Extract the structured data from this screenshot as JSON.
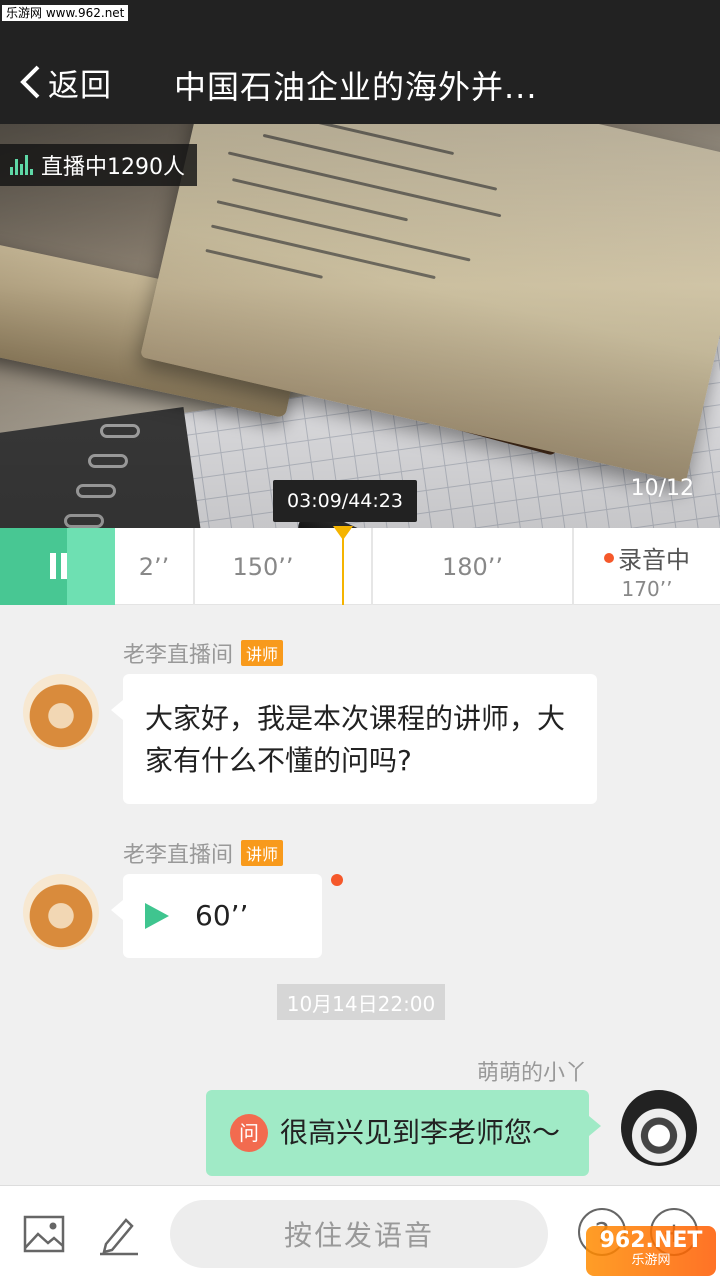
{
  "watermark": {
    "top": "乐游网 www.962.net",
    "bottom_brand": "962.NET",
    "bottom_sub": "乐游网"
  },
  "nav": {
    "back_label": "返回",
    "title": "中国石油企业的海外并..."
  },
  "hero": {
    "live_label": "直播中1290人",
    "page_counter": "10/12",
    "time_display": "03:09/44:23"
  },
  "timeline": {
    "segments": [
      "2’’",
      "150’’",
      "180’’"
    ],
    "recording_label": "录音中",
    "recording_duration": "170’’"
  },
  "messages": [
    {
      "sender": "老李直播间",
      "tag": "讲师",
      "text": "大家好，我是本次课程的讲师，大家有什么不懂的问吗?"
    },
    {
      "sender": "老李直播间",
      "tag": "讲师",
      "voice_duration": "60’’"
    },
    {
      "timestamp": "10月14日22:00"
    },
    {
      "sender": "萌萌的小丫",
      "question_icon": "问",
      "text": "很高兴见到李老师您～"
    }
  ],
  "bottom": {
    "voice_button": "按住发语音",
    "help_symbol": "?",
    "add_symbol": "+"
  },
  "colors": {
    "accent_green": "#48c793",
    "tag_orange": "#f89a1c",
    "record_red": "#f5582a",
    "playhead": "#f5b400"
  },
  "icons": [
    "back-arrow-icon",
    "live-bars-icon",
    "pause-icon",
    "play-icon",
    "image-icon",
    "pen-icon",
    "help-icon",
    "add-icon"
  ]
}
